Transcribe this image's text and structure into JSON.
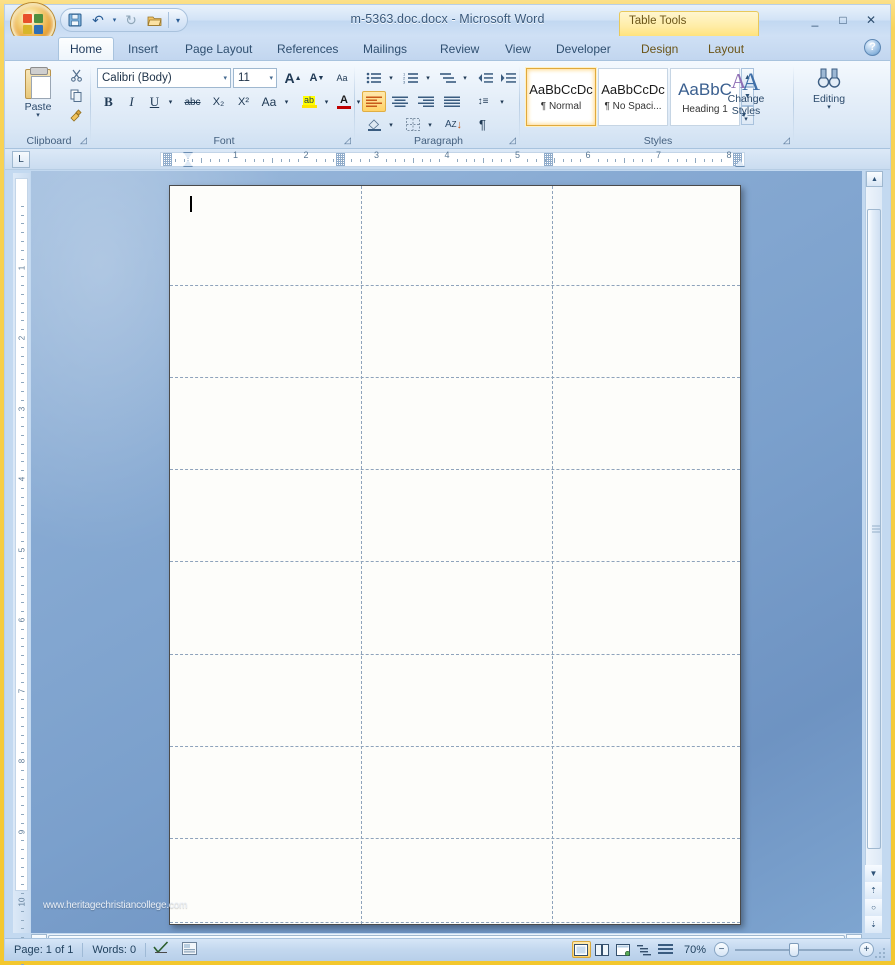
{
  "window": {
    "title": "m-5363.doc.docx - Microsoft Word",
    "contextual_tab_group": "Table Tools",
    "minimize": "_",
    "maximize": "□",
    "close": "✕",
    "help": "?"
  },
  "quick_access": {
    "items": [
      {
        "name": "save-button",
        "glyph": "💾"
      },
      {
        "name": "undo-button",
        "glyph": "↶"
      },
      {
        "name": "undo-dropdown",
        "glyph": "▾"
      },
      {
        "name": "redo-button",
        "glyph": "↻"
      },
      {
        "name": "open-button",
        "glyph": "📂"
      },
      {
        "name": "customize-qat-button",
        "glyph": "▾"
      }
    ]
  },
  "tabs": [
    {
      "label": "Home",
      "active": true
    },
    {
      "label": "Insert",
      "active": false
    },
    {
      "label": "Page Layout",
      "active": false
    },
    {
      "label": "References",
      "active": false
    },
    {
      "label": "Mailings",
      "active": false
    },
    {
      "label": "Review",
      "active": false
    },
    {
      "label": "View",
      "active": false
    },
    {
      "label": "Developer",
      "active": false
    },
    {
      "label": "Design",
      "active": false,
      "contextual": true
    },
    {
      "label": "Layout",
      "active": false,
      "contextual": true
    }
  ],
  "ribbon": {
    "groups": [
      {
        "name": "Clipboard"
      },
      {
        "name": "Font"
      },
      {
        "name": "Paragraph"
      },
      {
        "name": "Styles"
      },
      {
        "name": "Editing"
      }
    ],
    "clipboard": {
      "paste_label": "Paste",
      "cut_tooltip": "Cut",
      "copy_tooltip": "Copy",
      "format_painter_tooltip": "Format Painter"
    },
    "font": {
      "font_name": "Calibri (Body)",
      "font_size": "11",
      "grow_font": "A",
      "shrink_font": "A",
      "clear_formatting": "Aa",
      "bold": "B",
      "italic": "I",
      "underline": "U",
      "strikethrough": "abc",
      "subscript": "X₂",
      "superscript": "X²",
      "change_case": "Aa",
      "highlight": "ab",
      "font_color": "A"
    },
    "paragraph": {
      "bullets": "•≡",
      "numbering": "1≡",
      "multilevel": "≡",
      "decrease_indent": "←≡",
      "increase_indent": "≡→",
      "align_left": "≡",
      "align_center": "≡",
      "align_right": "≡",
      "justify": "≡",
      "line_spacing": "↕≡",
      "shading": "◇",
      "borders": "▦",
      "sort": "A↓",
      "show_marks": "¶"
    },
    "styles": {
      "gallery": [
        {
          "preview": "AaBbCcDc",
          "name": "¶ Normal",
          "selected": true
        },
        {
          "preview": "AaBbCcDc",
          "name": "¶ No Spaci...",
          "selected": false
        },
        {
          "preview": "AaBbC",
          "name": "Heading 1",
          "selected": false
        }
      ],
      "change_styles_label": "Change\nStyles",
      "change_styles_line1": "Change",
      "change_styles_line2": "Styles"
    },
    "editing": {
      "label": "Editing",
      "icon": "find-binoculars-icon"
    }
  },
  "ruler": {
    "horizontal_numbers": [
      "1",
      "2",
      "3",
      "4",
      "5",
      "6",
      "7",
      "8"
    ],
    "vertical_numbers": [
      "1",
      "2",
      "3",
      "4",
      "5",
      "6",
      "7",
      "8",
      "9",
      "10"
    ],
    "tab_selector": "L"
  },
  "document": {
    "watermark": "www.heritagechristiancollege.com",
    "table": {
      "columns": 3,
      "rows": 8,
      "cells_empty": true
    }
  },
  "status_bar": {
    "page": "Page: 1 of 1",
    "words": "Words: 0",
    "proofing_icon": "spelling-check-icon",
    "language_icon": "language-icon",
    "views": [
      {
        "name": "print-layout",
        "glyph": "▤",
        "active": true
      },
      {
        "name": "full-screen-reading",
        "glyph": "▥",
        "active": false
      },
      {
        "name": "web-layout",
        "glyph": "▦",
        "active": false
      },
      {
        "name": "outline",
        "glyph": "≣",
        "active": false
      },
      {
        "name": "draft",
        "glyph": "≡",
        "active": false
      }
    ],
    "zoom_level": "70%",
    "zoom_out": "−",
    "zoom_in": "+"
  }
}
